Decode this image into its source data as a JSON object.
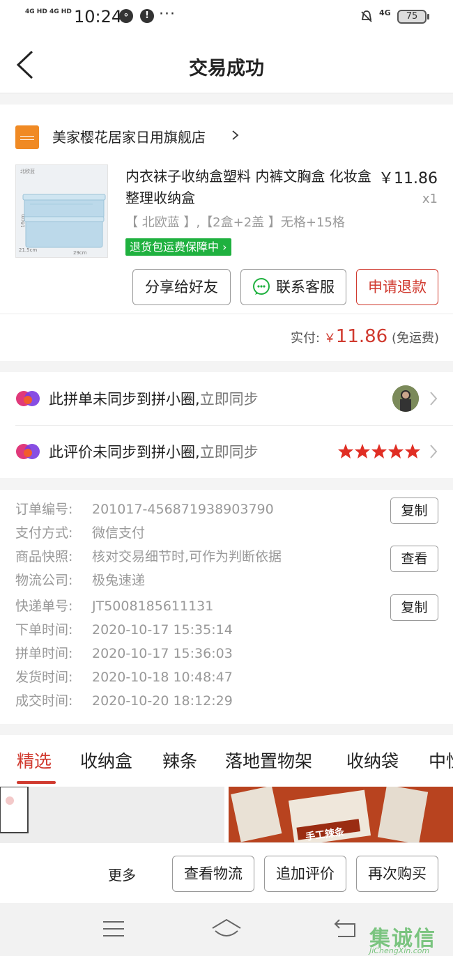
{
  "status_bar": {
    "signal1": "4G HD",
    "signal2": "4G HD",
    "time": "10:24",
    "network": "4G",
    "battery": "75"
  },
  "nav": {
    "title": "交易成功"
  },
  "shop": {
    "name": "美家樱花居家日用旗舰店"
  },
  "product": {
    "title": "内衣袜子收纳盒塑料 内裤文胸盒 化妆盒 整理收纳盒",
    "price": "￥11.86",
    "qty": "x1",
    "spec": "【 北欧蓝 】,【2盒+2盖 】无格+15格",
    "guarantee": "退货包运费保障中",
    "img_labels": {
      "top": "北欧蓝",
      "width": "21.5cm",
      "length": "29cm",
      "height": "16cm"
    }
  },
  "actions": {
    "share": "分享给好友",
    "contact": "联系客服",
    "refund": "申请退款"
  },
  "payment": {
    "label": "实付:",
    "currency": "￥",
    "amount": "11.86",
    "shipping": "(免运费)"
  },
  "sync": {
    "order_text": "此拼单未同步到拼小圈,",
    "order_action": "立即同步",
    "review_text": "此评价未同步到拼小圈,",
    "review_action": "立即同步",
    "star_rating": 5,
    "star_color": "#e02e24"
  },
  "order_info": {
    "rows": [
      {
        "label": "订单编号:",
        "value": "201017-456871938903790"
      },
      {
        "label": "支付方式:",
        "value": "微信支付"
      },
      {
        "label": "商品快照:",
        "value": "核对交易细节时,可作为判断依据"
      },
      {
        "label": "物流公司:",
        "value": "极兔速递"
      },
      {
        "label": "快递单号:",
        "value": "JT5008185611131"
      },
      {
        "label": "下单时间:",
        "value": "2020-10-17 15:35:14"
      },
      {
        "label": "拼单时间:",
        "value": "2020-10-17 15:36:03"
      },
      {
        "label": "发货时间:",
        "value": "2020-10-18 10:48:47"
      },
      {
        "label": "成交时间:",
        "value": "2020-10-20 18:12:29"
      }
    ],
    "copy_label": "复制",
    "view_label": "查看",
    "copy2_label": "复制"
  },
  "tabs": [
    "精选",
    "收纳盒",
    "辣条",
    "落地置物架",
    "收纳袋",
    "中性"
  ],
  "promo": {
    "snack_text": "手工辣条"
  },
  "bottom": {
    "more": "更多",
    "logistics": "查看物流",
    "add_review": "追加评价",
    "rebuy": "再次购买"
  },
  "watermark": {
    "main": "集诚信",
    "sub": "JiChengXin.com"
  },
  "colors": {
    "accent_red": "#d03a2f",
    "guarantee_green": "#1fb13f",
    "shop_orange": "#f08a24"
  }
}
